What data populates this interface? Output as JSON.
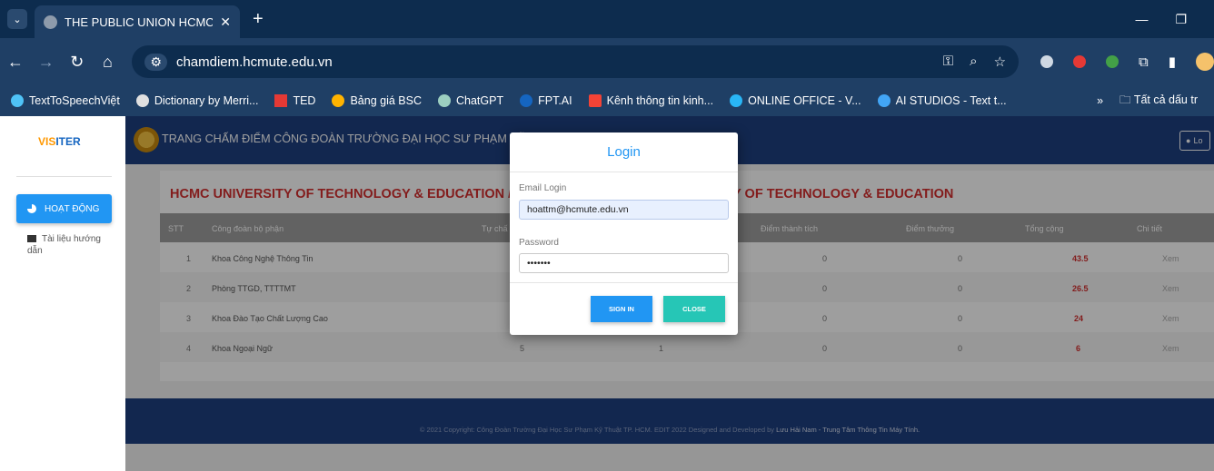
{
  "browser": {
    "tab_title": "THE PUBLIC UNION HCMC UNI",
    "url": "chamdiem.hcmute.edu.vn",
    "bookmarks": [
      "TextToSpeechViệt",
      "Dictionary by Merri...",
      "TED",
      "Bảng giá BSC",
      "ChatGPT",
      "FPT.AI",
      "Kênh thông tin kinh...",
      "ONLINE OFFICE - V...",
      "AI STUDIOS - Text t..."
    ],
    "all_bookmarks": "Tất cả dấu tr"
  },
  "sidebar": {
    "logo_a": "VIS",
    "logo_b": "ITER",
    "active_item": "HOẠT ĐỘNG",
    "item": "Tài liệu hướng dẫn"
  },
  "header": {
    "title": "TRANG CHẤM ĐIỂM CÔNG ĐOÀN TRƯỜNG ĐẠI HỌC SƯ PHẠM KỸ TH",
    "login": "Lo"
  },
  "main": {
    "title_left": "HCMC UNIVERSITY OF TECHNOLOGY & EDUCATION / T",
    "title_right": "Y OF TECHNOLOGY & EDUCATION",
    "columns": [
      "STT",
      "Công đoàn bộ phận",
      "Tự chấ",
      "Điểm thành tích",
      "Điểm thưởng",
      "Tổng cộng",
      "Chi tiết"
    ],
    "rows": [
      {
        "stt": "1",
        "name": "Khoa Công Nghệ Thông Tin",
        "self": "",
        "mid": "",
        "achieve": "0",
        "bonus": "0",
        "total": "43.5",
        "detail": "Xem"
      },
      {
        "stt": "2",
        "name": "Phòng TTGD, TTTTMT",
        "self": "",
        "mid": "",
        "achieve": "0",
        "bonus": "0",
        "total": "26.5",
        "detail": "Xem"
      },
      {
        "stt": "3",
        "name": "Khoa Đào Tạo Chất Lượng Cao",
        "self": "",
        "mid": "",
        "achieve": "0",
        "bonus": "0",
        "total": "24",
        "detail": "Xem"
      },
      {
        "stt": "4",
        "name": "Khoa Ngoại Ngữ",
        "self": "5",
        "mid": "1",
        "achieve": "0",
        "bonus": "0",
        "total": "6",
        "detail": "Xem"
      }
    ]
  },
  "footer": {
    "text": "© 2021 Copyright: Công Đoàn Trường Đại Học Sư Phạm Kỹ Thuật TP. HCM. EDIT 2022 Designed and Developed by ",
    "author": "Lưu Hải Nam - Trung Tâm Thông Tin Máy Tính."
  },
  "modal": {
    "title": "Login",
    "email_label": "Email Login",
    "email_value": "hoattm@hcmute.edu.vn",
    "password_label": "Password",
    "password_value": "hoattm1",
    "signin": "SIGN IN",
    "close": "CLOSE"
  },
  "colors": {
    "header": "#1d3f80",
    "accent": "#2196f3",
    "close": "#26c6b6",
    "title_red": "#d32f2f"
  }
}
